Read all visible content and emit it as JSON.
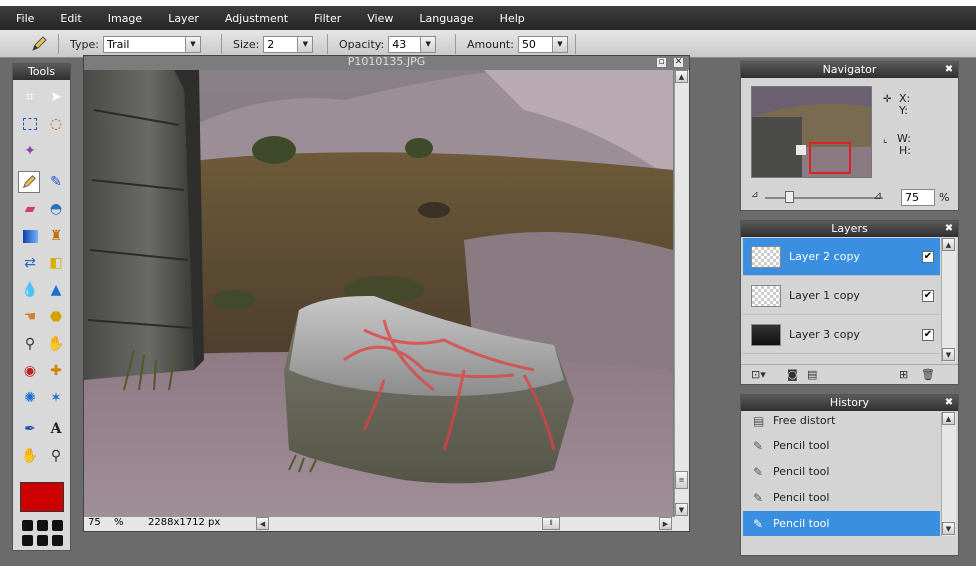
{
  "menu": [
    "File",
    "Edit",
    "Image",
    "Layer",
    "Adjustment",
    "Filter",
    "View",
    "Language",
    "Help"
  ],
  "options": {
    "type_label": "Type:",
    "type_value": "Trail",
    "size_label": "Size:",
    "size_value": "2",
    "opacity_label": "Opacity:",
    "opacity_value": "43",
    "amount_label": "Amount:",
    "amount_value": "50"
  },
  "tools_title": "Tools",
  "foreground_color": "#cc0000",
  "document": {
    "title": "P1010135.JPG",
    "zoom": "75",
    "zoom_unit": "%",
    "dimensions": "2288x1712 px"
  },
  "navigator": {
    "title": "Navigator",
    "x_label": "X:",
    "y_label": "Y:",
    "w_label": "W:",
    "h_label": "H:",
    "zoom": "75",
    "zoom_unit": "%"
  },
  "layers": {
    "title": "Layers",
    "items": [
      {
        "name": "Layer 2 copy",
        "selected": true
      },
      {
        "name": "Layer 1 copy",
        "selected": false
      },
      {
        "name": "Layer 3 copy",
        "selected": false
      }
    ]
  },
  "history": {
    "title": "History",
    "items": [
      "Free distort",
      "Pencil tool",
      "Pencil tool",
      "Pencil tool",
      "Pencil tool"
    ]
  }
}
